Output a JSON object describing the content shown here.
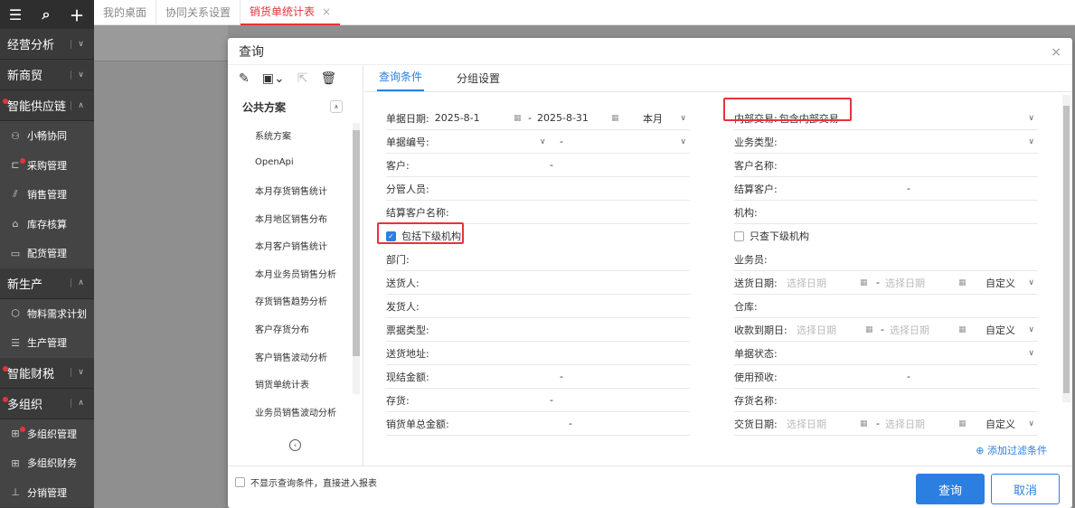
{
  "sidebar": {
    "top_icons": [
      "menu-icon",
      "search-icon",
      "plus-icon"
    ],
    "groups": [
      {
        "label": "经营分析",
        "arrow": "∨"
      },
      {
        "label": "新商贸",
        "arrow": "∨"
      },
      {
        "label": "智能供应链",
        "arrow": "∧"
      },
      {
        "label": "新生产",
        "arrow": "∧"
      },
      {
        "label": "智能财税",
        "arrow": "∨"
      },
      {
        "label": "多组织",
        "arrow": "∧"
      }
    ],
    "supply_items": [
      "小畅协同",
      "采购管理",
      "销售管理",
      "库存核算",
      "配货管理"
    ],
    "production_items": [
      "物料需求计划",
      "生产管理"
    ],
    "org_items": [
      "多组织管理",
      "多组织财务",
      "分销管理"
    ]
  },
  "tabs": [
    {
      "label": "我的桌面"
    },
    {
      "label": "协同关系设置"
    },
    {
      "label": "销货单统计表",
      "close": "×"
    }
  ],
  "dialog": {
    "title": "查询",
    "close": "×",
    "scheme_title": "公共方案",
    "collapse": "∧",
    "schemes": [
      "系统方案",
      "OpenApi",
      "本月存货销售统计",
      "本月地区销售分布",
      "本月客户销售统计",
      "本月业务员销售分析",
      "存货销售趋势分析",
      "客户存货分布",
      "客户销售波动分析",
      "销货单统计表",
      "业务员销售波动分析"
    ],
    "right_tabs": [
      "查询条件",
      "分组设置"
    ],
    "left_fields": {
      "date_label": "单据日期:",
      "date_from": "2025-8-1",
      "date_to": "2025-8-31",
      "date_range": "本月",
      "code_label": "单据编号:",
      "customer": "客户:",
      "manager": "分管人员:",
      "settle_name": "结算客户名称:",
      "include_sub": "包括下级机构",
      "dept": "部门:",
      "deliverer": "送货人:",
      "sender": "发货人:",
      "invoice_type": "票据类型:",
      "address": "送货地址:",
      "cash_amount": "现结金额:",
      "inventory": "存货:",
      "total_amount": "销货单总金额:"
    },
    "right_fields": {
      "internal_label": "内部交易:",
      "internal_value": "包含内部交易",
      "biz_type": "业务类型:",
      "customer_name": "客户名称:",
      "settle_customer": "结算客户:",
      "org": "机构:",
      "only_sub": "只查下级机构",
      "salesman": "业务员:",
      "delivery_date": "送货日期:",
      "warehouse": "仓库:",
      "receivable_date": "收款到期日:",
      "doc_status": "单据状态:",
      "prepay": "使用预收:",
      "inv_name": "存货名称:",
      "deal_date": "交货日期:",
      "date_placeholder": "选择日期",
      "custom": "自定义"
    },
    "dash": "-",
    "add_filter": "添加过滤条件",
    "skip_label": "不显示查询条件，直接进入报表",
    "query_btn": "查询",
    "cancel_btn": "取消"
  }
}
